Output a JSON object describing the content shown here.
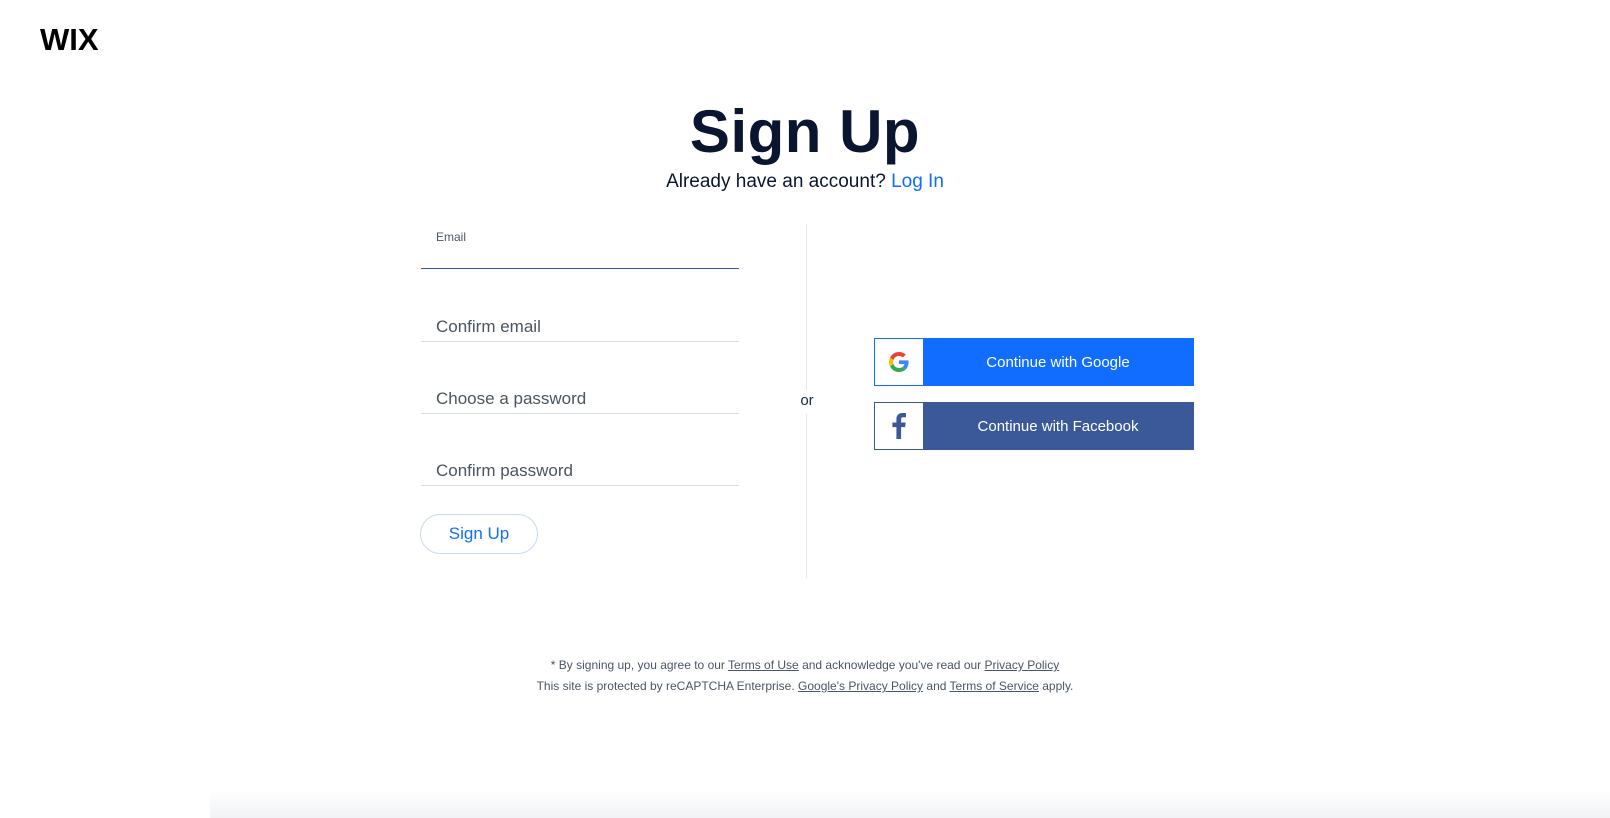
{
  "brand": {
    "logo_text": "WIX"
  },
  "header": {
    "title": "Sign Up",
    "subtitle_text": "Already have an account?",
    "login_link": "Log In"
  },
  "form": {
    "email": {
      "label": "Email",
      "value": ""
    },
    "confirm_email": {
      "placeholder": "Confirm email"
    },
    "password": {
      "placeholder": "Choose a password"
    },
    "confirm_password": {
      "placeholder": "Confirm password"
    },
    "submit_label": "Sign Up"
  },
  "divider": {
    "text": "or"
  },
  "social": {
    "google_label": "Continue with Google",
    "facebook_label": "Continue with Facebook"
  },
  "footer": {
    "line1_prefix": "* By signing up, you agree to our",
    "terms_of_use": "Terms of Use",
    "line1_middle": "and acknowledge you've read our",
    "privacy_policy": "Privacy Policy",
    "line2_prefix": "This site is protected by reCAPTCHA Enterprise.",
    "google_privacy_policy": "Google's Privacy Policy",
    "line2_and": "and",
    "terms_of_service": "Terms of Service",
    "line2_suffix": "apply."
  },
  "colors": {
    "accent": "#116dff",
    "facebook": "#3b5998",
    "title": "#0a1530"
  }
}
